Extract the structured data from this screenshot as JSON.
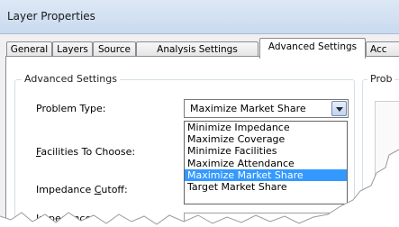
{
  "window": {
    "title": "Layer Properties"
  },
  "tabs": [
    {
      "label": "General"
    },
    {
      "label": "Layers"
    },
    {
      "label": "Source"
    },
    {
      "label": "Analysis Settings"
    },
    {
      "label": "Advanced Settings",
      "active": true
    },
    {
      "label": "Acc"
    }
  ],
  "advanced_group": {
    "label": "Advanced Settings"
  },
  "right_group": {
    "label": "Prob"
  },
  "fields": {
    "problem_type": {
      "label": "Problem Type:",
      "value": "Maximize Market Share"
    },
    "facilities_to_choose": {
      "label_underlined": "F",
      "label_rest": "acilities To Choose:"
    },
    "impedance_cutoff": {
      "label_before": "Impedance ",
      "label_underlined": "C",
      "label_after": "utoff:"
    },
    "impedance": {
      "label": "Impedance"
    }
  },
  "dropdown": {
    "options": [
      "Minimize Impedance",
      "Maximize Coverage",
      "Minimize Facilities",
      "Maximize Attendance",
      "Maximize Market Share",
      "Target Market Share"
    ],
    "selected_index": 4
  },
  "colors": {
    "selection": "#3399ff",
    "titlebar": "#c9daef"
  }
}
